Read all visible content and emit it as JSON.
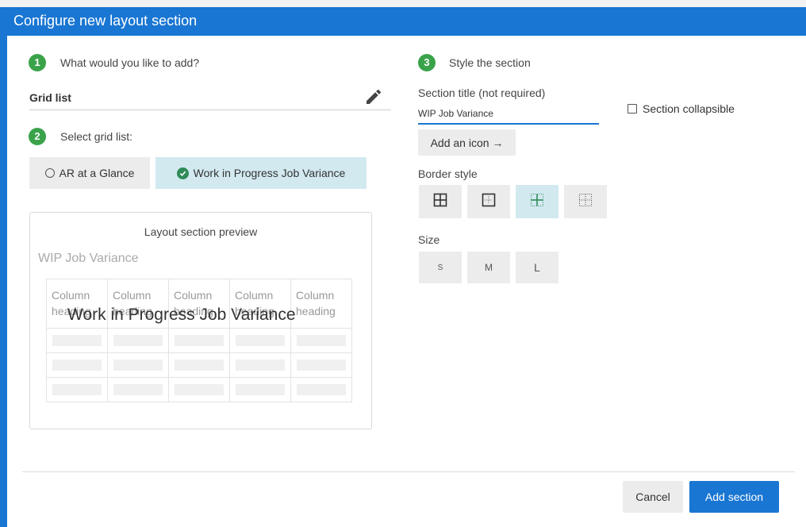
{
  "dialog": {
    "title": "Configure new layout section"
  },
  "step1": {
    "number": "1",
    "label": "What would you like to add?",
    "value": "Grid list",
    "edit_icon": "pencil-icon"
  },
  "step2": {
    "number": "2",
    "label": "Select grid list:",
    "options": [
      {
        "label": "AR at a Glance",
        "selected": false
      },
      {
        "label": "Work in Progress Job Variance",
        "selected": true
      }
    ]
  },
  "preview": {
    "title": "Layout section preview",
    "section_title": "WIP Job Variance",
    "column_headers": [
      "Column heading",
      "Column heading",
      "Column heading",
      "Column heading",
      "Column heading"
    ],
    "overlay": "Work in Progress Job Variance"
  },
  "step3": {
    "number": "3",
    "label": "Style the section",
    "section_title_label": "Section title (not required)",
    "section_title_value": "WIP Job Variance",
    "collapsible_label": "Section collapsible",
    "collapsible_checked": false,
    "add_icon_label": "Add an icon →",
    "border_style_label": "Border style",
    "border_styles": [
      "all-borders-icon",
      "outer-dotted-inner-icon",
      "inner-borders-icon",
      "dotted-grid-icon"
    ],
    "border_selected_index": 2,
    "size_label": "Size",
    "sizes": [
      "S",
      "M",
      "L"
    ]
  },
  "footer": {
    "cancel_label": "Cancel",
    "add_label": "Add section"
  },
  "colors": {
    "primary": "#1976d2",
    "step_badge": "#3aa34a",
    "selected_bg": "#d2e9f0"
  }
}
